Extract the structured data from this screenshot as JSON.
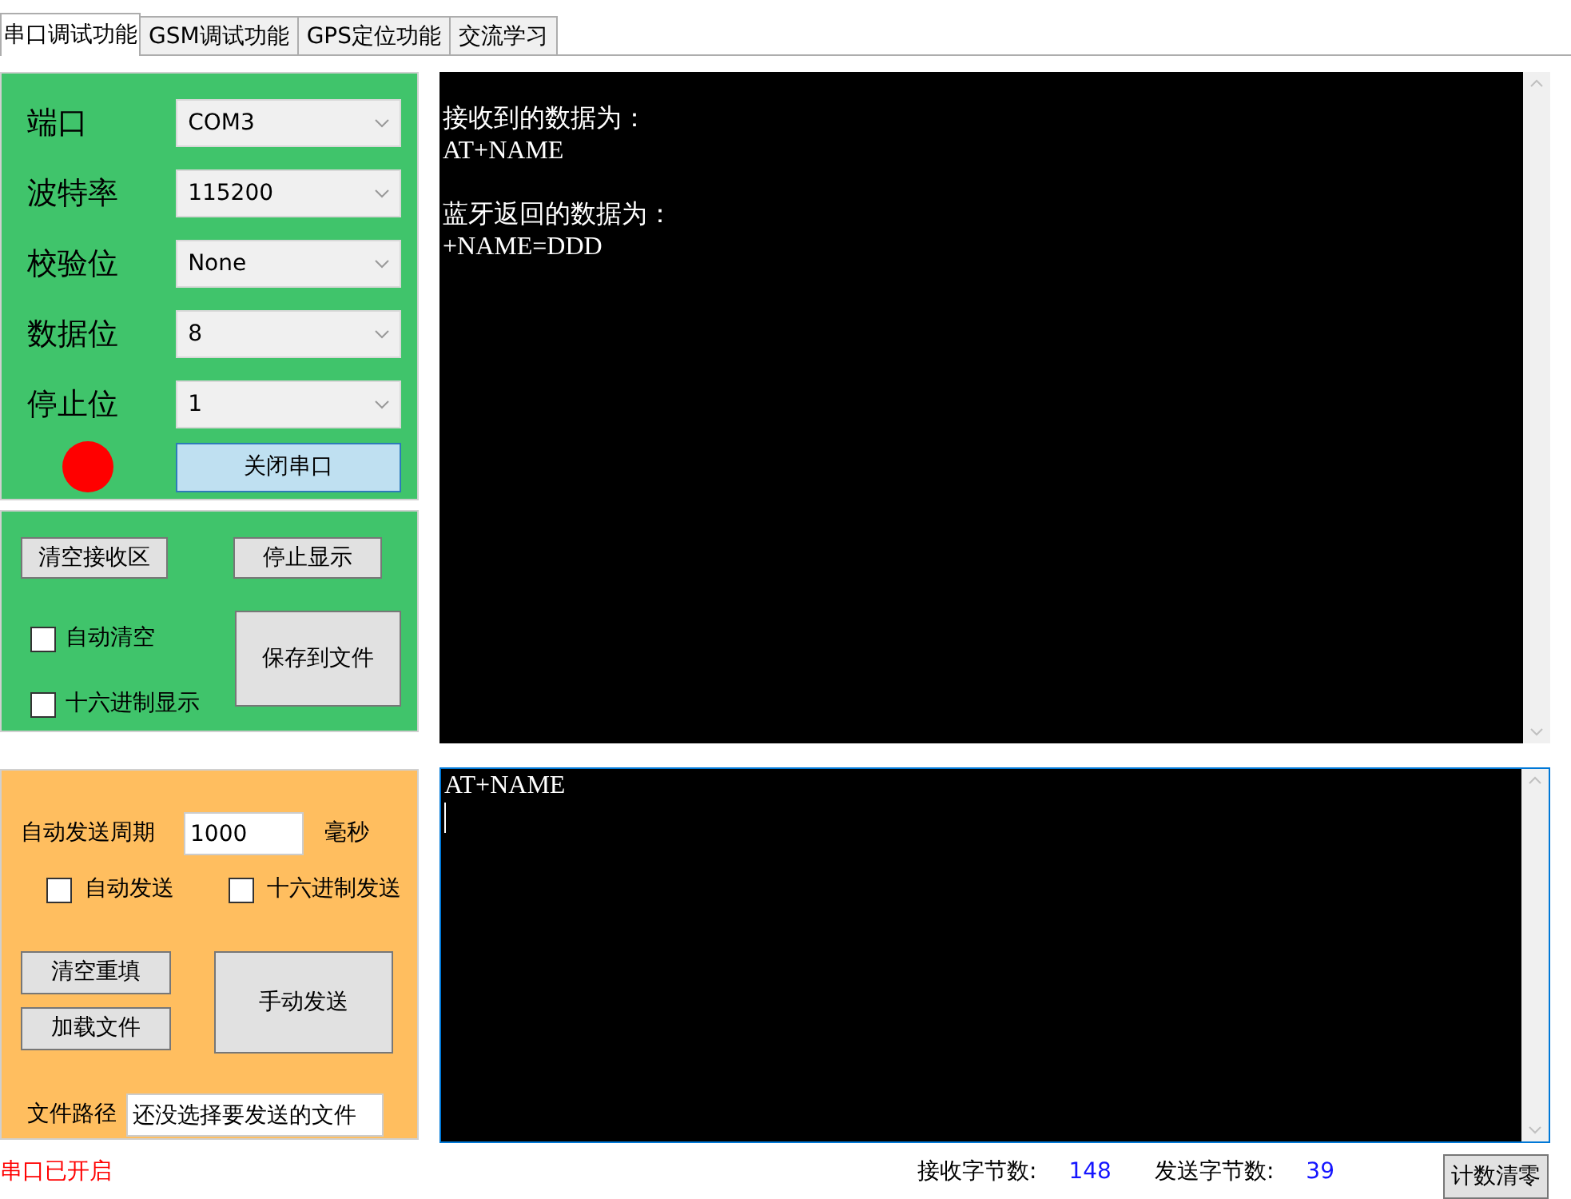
{
  "tabs": [
    {
      "label": "串口调试功能",
      "selected": true
    },
    {
      "label": "GSM调试功能",
      "selected": false
    },
    {
      "label": "GPS定位功能",
      "selected": false
    },
    {
      "label": "交流学习",
      "selected": false
    }
  ],
  "serial_settings": {
    "fields": [
      {
        "label": "端口",
        "value": "COM3"
      },
      {
        "label": "波特率",
        "value": "115200"
      },
      {
        "label": "校验位",
        "value": "None"
      },
      {
        "label": "数据位",
        "value": "8"
      },
      {
        "label": "停止位",
        "value": "1"
      }
    ],
    "port_open": true,
    "toggle_button": "关闭串口"
  },
  "receive_options": {
    "clear_button": "清空接收区",
    "pause_button": "停止显示",
    "save_button": "保存到文件",
    "checkboxes": [
      {
        "label": "自动清空",
        "checked": false
      },
      {
        "label": "十六进制显示",
        "checked": false
      }
    ]
  },
  "receive_log": [
    {
      "heading": "接收到的数据为：",
      "data": "AT+NAME"
    },
    {
      "heading": "蓝牙返回的数据为：",
      "data": "+NAME=DDD"
    }
  ],
  "send_options": {
    "period_label": "自动发送周期",
    "period_value": "1000",
    "period_unit": "毫秒",
    "checkboxes": [
      {
        "label": "自动发送",
        "checked": false
      },
      {
        "label": "十六进制发送",
        "checked": false
      }
    ],
    "clear_button": "清空重填",
    "load_button": "加载文件",
    "send_button": "手动发送",
    "path_label": "文件路径",
    "path_value": "还没选择要发送的文件"
  },
  "send_text": "AT+NAME",
  "status_bar": {
    "status": "串口已开启",
    "received_label": "接收字节数:",
    "received_count": "148",
    "sent_label": "发送字节数:",
    "sent_count": "39",
    "reset_button": "计数清零"
  }
}
